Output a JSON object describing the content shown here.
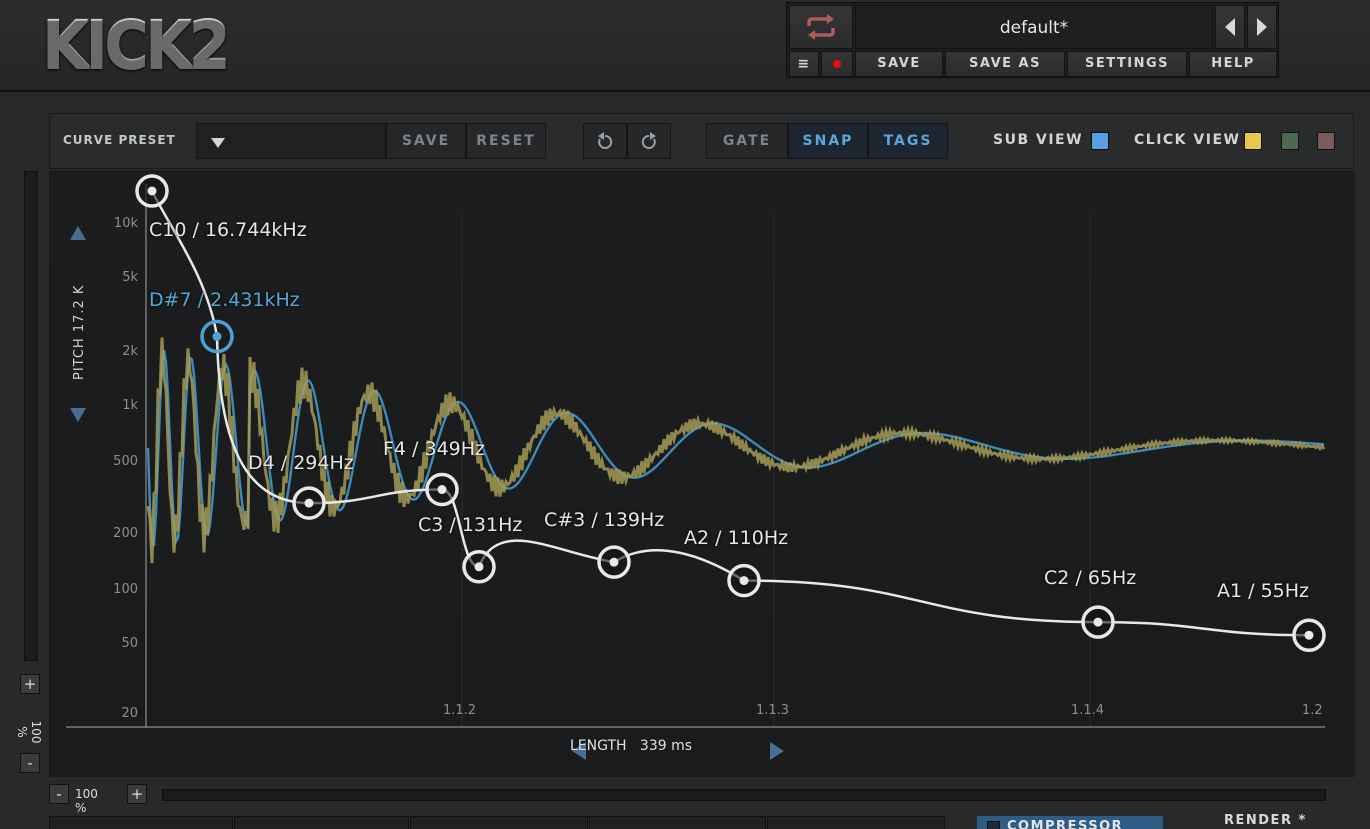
{
  "app": {
    "logo": "KICK2"
  },
  "header": {
    "preset_name": "default*",
    "loop_icon": "loop-arrows-icon",
    "menu_icon": "hamburger-menu-icon",
    "record_icon": "record-dot-icon",
    "buttons": {
      "save": "SAVE",
      "save_as": "SAVE AS",
      "settings": "SETTINGS",
      "help": "HELP"
    },
    "record_color": "#e01010",
    "loop_color": "#b25a5a"
  },
  "toolbar": {
    "curve_preset_label": "CURVE PRESET",
    "save": "SAVE",
    "reset": "RESET",
    "gate": "GATE",
    "snap": "SNAP",
    "tags": "TAGS",
    "sub_view_label": "SUB VIEW",
    "click_view_label": "CLICK VIEW",
    "swatch_colors": {
      "sub": "#5a9ee6",
      "click_yellow": "#e6c94a",
      "click_green": "#4b6b4e",
      "click_brown": "#7a5a5a"
    }
  },
  "editor": {
    "pitch_axis_label": "PITCH 17.2 K",
    "length_label": "LENGTH",
    "length_value": "339 ms",
    "y_ticks": [
      "10k",
      "5k",
      "2k",
      "1k",
      "500",
      "200",
      "100",
      "50",
      "20"
    ],
    "x_ticks": [
      "1.1.2",
      "1.1.3",
      "1.1.4",
      "1.2"
    ],
    "nodes": [
      {
        "label": "C10 / 16.744kHz",
        "freq": 16744,
        "selected": false
      },
      {
        "label": "D#7 / 2.431kHz",
        "freq": 2431,
        "selected": true
      },
      {
        "label": "D4 / 294Hz",
        "freq": 294,
        "selected": false
      },
      {
        "label": "F4 / 349Hz",
        "freq": 349,
        "selected": false
      },
      {
        "label": "C3 / 131Hz",
        "freq": 131,
        "selected": false
      },
      {
        "label": "C#3 / 139Hz",
        "freq": 139,
        "selected": false
      },
      {
        "label": "A2 / 110Hz",
        "freq": 110,
        "selected": false
      },
      {
        "label": "C2 / 65Hz",
        "freq": 65,
        "selected": false
      },
      {
        "label": "A1 / 55Hz",
        "freq": 55,
        "selected": false
      }
    ],
    "colors": {
      "curve": "#e8e8e8",
      "selected": "#4aa3d4",
      "wave_sub": "#3e8ab8",
      "wave_click": "#a59a55"
    }
  },
  "zoom": {
    "vertical": {
      "plus": "+",
      "minus": "-",
      "value": "100 %"
    },
    "horizontal": {
      "plus": "+",
      "minus": "-",
      "value": "100 %"
    }
  },
  "bottom": {
    "compressor": "COMPRESSOR",
    "render": "RENDER *"
  }
}
